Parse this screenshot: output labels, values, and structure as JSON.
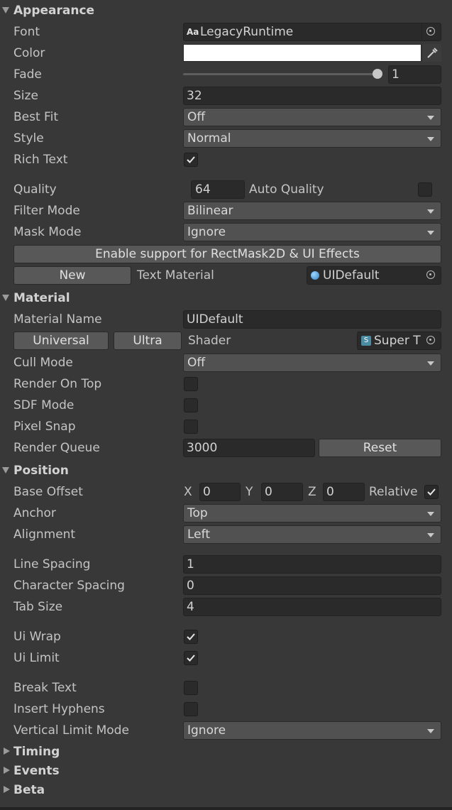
{
  "appearance": {
    "header": "Appearance",
    "font": {
      "label": "Font",
      "value": "LegacyRuntime",
      "icon_text": "Aa"
    },
    "color": {
      "label": "Color",
      "value": "#ffffff"
    },
    "fade": {
      "label": "Fade",
      "value": "1",
      "slider_fraction": 1.0
    },
    "size": {
      "label": "Size",
      "value": "32"
    },
    "best_fit": {
      "label": "Best Fit",
      "value": "Off"
    },
    "style": {
      "label": "Style",
      "value": "Normal"
    },
    "rich_text": {
      "label": "Rich Text",
      "checked": true
    },
    "quality": {
      "label": "Quality",
      "value": "64",
      "auto_label": "Auto Quality",
      "auto_checked": false
    },
    "filter_mode": {
      "label": "Filter Mode",
      "value": "Bilinear"
    },
    "mask_mode": {
      "label": "Mask Mode",
      "value": "Ignore"
    },
    "enable_button": "Enable support for RectMask2D & UI Effects",
    "new_button": "New",
    "text_material_label": "Text Material",
    "text_material_value": "UIDefault"
  },
  "material": {
    "header": "Material",
    "material_name": {
      "label": "Material Name",
      "value": "UIDefault"
    },
    "universal_button": "Universal",
    "ultra_button": "Ultra",
    "shader_label": "Shader",
    "shader_value": "Super T",
    "shader_icon_text": "S",
    "cull_mode": {
      "label": "Cull Mode",
      "value": "Off"
    },
    "render_on_top": {
      "label": "Render On Top",
      "checked": false
    },
    "sdf_mode": {
      "label": "SDF Mode",
      "checked": false
    },
    "pixel_snap": {
      "label": "Pixel Snap",
      "checked": false
    },
    "render_queue": {
      "label": "Render Queue",
      "value": "3000",
      "reset_button": "Reset"
    }
  },
  "position": {
    "header": "Position",
    "base_offset": {
      "label": "Base Offset",
      "x_label": "X",
      "x": "0",
      "y_label": "Y",
      "y": "0",
      "z_label": "Z",
      "z": "0",
      "relative_label": "Relative",
      "relative_checked": true
    },
    "anchor": {
      "label": "Anchor",
      "value": "Top"
    },
    "alignment": {
      "label": "Alignment",
      "value": "Left"
    },
    "line_spacing": {
      "label": "Line Spacing",
      "value": "1"
    },
    "character_spacing": {
      "label": "Character Spacing",
      "value": "0"
    },
    "tab_size": {
      "label": "Tab Size",
      "value": "4"
    },
    "ui_wrap": {
      "label": "Ui Wrap",
      "checked": true
    },
    "ui_limit": {
      "label": "Ui Limit",
      "checked": true
    },
    "break_text": {
      "label": "Break Text",
      "checked": false
    },
    "insert_hyphens": {
      "label": "Insert Hyphens",
      "checked": false
    },
    "vertical_limit_mode": {
      "label": "Vertical Limit Mode",
      "value": "Ignore"
    }
  },
  "collapsed_sections": {
    "timing": "Timing",
    "events": "Events",
    "beta": "Beta"
  },
  "colors": {
    "panel_bg": "#383838",
    "field_bg": "#2a2a2a",
    "dropdown_bg": "#515151",
    "button_bg": "#585858",
    "text": "#c4c4c4"
  }
}
